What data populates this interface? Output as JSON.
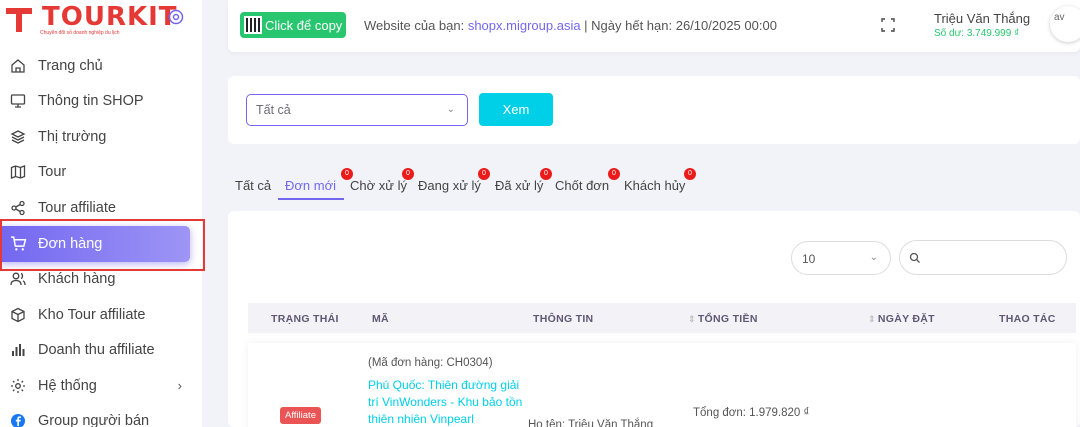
{
  "brand": {
    "name": "TOURKIT",
    "tagline": "Chuyển đổi số doanh nghiệp du lịch"
  },
  "sidebar": {
    "items": [
      {
        "label": "Trang chủ",
        "icon": "home-icon"
      },
      {
        "label": "Thông tin SHOP",
        "icon": "monitor-icon"
      },
      {
        "label": "Thị trường",
        "icon": "layers-icon"
      },
      {
        "label": "Tour",
        "icon": "map-icon"
      },
      {
        "label": "Tour affiliate",
        "icon": "share-icon"
      },
      {
        "label": "Đơn hàng",
        "icon": "cart-icon",
        "active": true
      },
      {
        "label": "Khách hàng",
        "icon": "users-icon"
      },
      {
        "label": "Kho Tour affiliate",
        "icon": "box-icon"
      },
      {
        "label": "Doanh thu affiliate",
        "icon": "bar-chart-icon"
      },
      {
        "label": "Hệ thống",
        "icon": "settings-icon",
        "has_submenu": true
      },
      {
        "label": "Group người bán",
        "icon": "facebook-icon"
      }
    ]
  },
  "topbar": {
    "copy_label": "Click để copy",
    "site_prefix": "Website của bạn: ",
    "site_url": "shopx.migroup.asia",
    "expiry": " | Ngày hết hạn: 26/10/2025 00:00",
    "user_name": "Triệu Văn Thắng",
    "balance": "Số dư: 3.749.999 ₫",
    "avatar_alt": "av"
  },
  "filter": {
    "selected": "Tất cả",
    "button": "Xem"
  },
  "tabs": [
    {
      "label": "Tất cả",
      "badge": ""
    },
    {
      "label": "Đơn mới",
      "badge": "0",
      "active": true
    },
    {
      "label": "Chờ xử lý",
      "badge": "0"
    },
    {
      "label": "Đang xử lý",
      "badge": "0"
    },
    {
      "label": "Đã xử lý",
      "badge": "0"
    },
    {
      "label": "Chốt đơn",
      "badge": "0"
    },
    {
      "label": "Khách hủy",
      "badge": "0"
    }
  ],
  "table": {
    "page_size": "10",
    "search_value": "",
    "headers": [
      "Trạng thái",
      "Mã",
      "Thông tin",
      "Tổng tiền",
      "Ngày đặt",
      "Thao tác"
    ],
    "rows": [
      {
        "order_code": "(Mã đơn hàng: CH0304)",
        "tour": "Phú Quốc: Thiên đường giải trí VinWonders - Khu bảo tồn thiên nhiên Vinpearl",
        "status": "Affiliate",
        "customer": "Họ tên: Triệu Văn Thắng",
        "total": "Tổng đơn: 1.979.820 ₫"
      }
    ]
  },
  "colors": {
    "primary": "#7367f0",
    "success": "#28c76f",
    "info": "#00cfe8",
    "danger": "#ea5455"
  }
}
